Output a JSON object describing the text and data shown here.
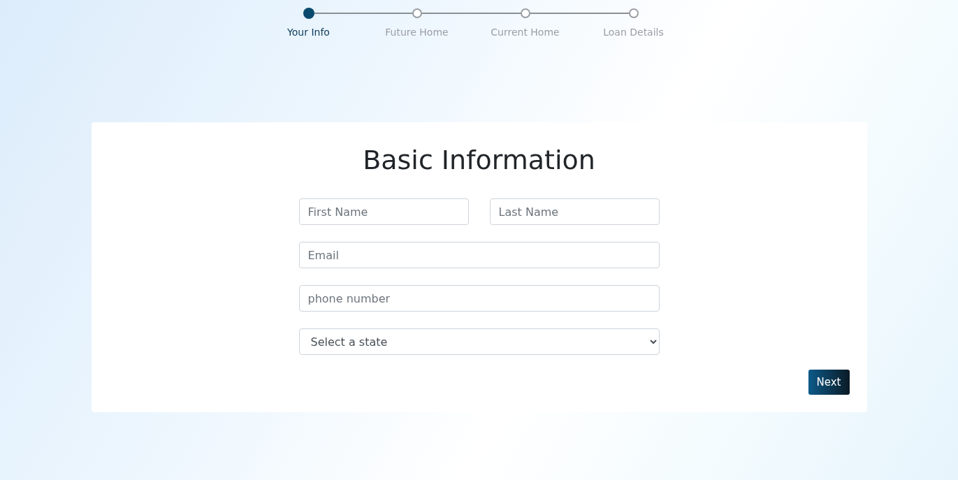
{
  "stepper": [
    {
      "label": "Your Info",
      "selected": true
    },
    {
      "label": "Future Home",
      "selected": false
    },
    {
      "label": "Current Home",
      "selected": false
    },
    {
      "label": "Loan Details",
      "selected": false
    }
  ],
  "form": {
    "title": "Basic Information",
    "name_fields": [
      {
        "placeholder": "First Name"
      },
      {
        "placeholder": "Last Name"
      }
    ],
    "email": {
      "placeholder": "Email"
    },
    "phone": {
      "placeholder": "phone number"
    },
    "state_select": {
      "value": "Select a state"
    },
    "next_button": "Next"
  }
}
